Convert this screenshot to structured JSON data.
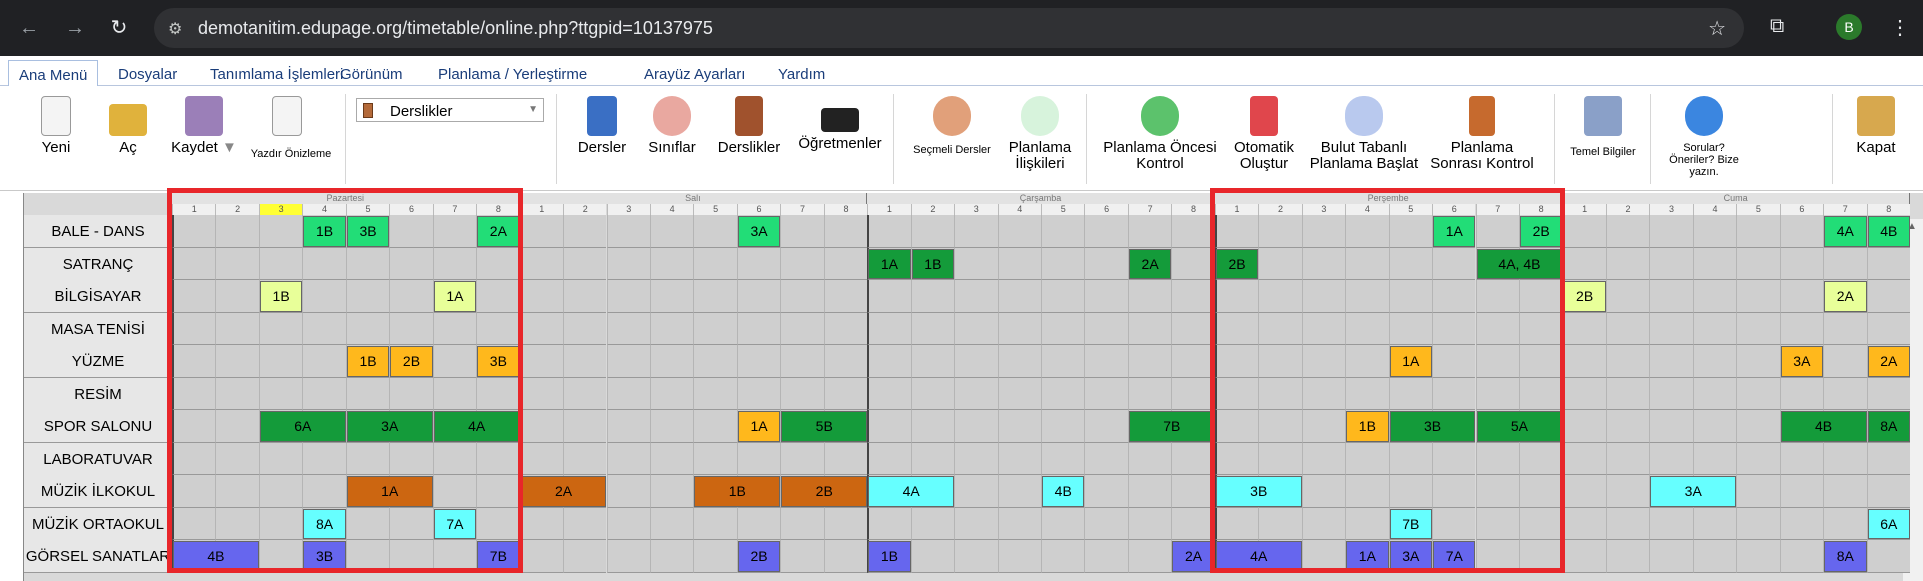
{
  "browser": {
    "url": "demotanitim.edupage.org/timetable/online.php?ttgpid=10137975",
    "profile_initial": "B"
  },
  "menubar": [
    "Ana Menü",
    "Dosyalar",
    "Tanımlama İşlemleri",
    "Görünüm",
    "Planlama / Yerleştirme",
    "Arayüz Ayarları",
    "Yardım"
  ],
  "ribbon": {
    "new": "Yeni",
    "open": "Aç",
    "save": "Kaydet",
    "print": "Yazdır Önizleme",
    "view_select": "Derslikler",
    "subjects": "Dersler",
    "classes": "Sınıflar",
    "rooms": "Derslikler",
    "teachers": "Öğretmenler",
    "elective": "Seçmeli Dersler",
    "relations": "Planlama İlişkileri",
    "precheck": "Planlama Öncesi Kontrol",
    "auto": "Otomatik Oluştur",
    "cloud": "Bulut Tabanlı Planlama Başlat",
    "postcheck": "Planlama Sonrası Kontrol",
    "basic": "Temel Bilgiler",
    "questions": "Sorular? Öneriler? Bize yazın.",
    "close": "Kapat"
  },
  "days": [
    "Pazartesi",
    "Salı",
    "Çarşamba",
    "Perşembe",
    "Cuma"
  ],
  "periods": [
    "1",
    "2",
    "3",
    "4",
    "5",
    "6",
    "7",
    "8"
  ],
  "highlight_period": {
    "day": 0,
    "period": 2
  },
  "rooms": [
    "BALE - DANS",
    "SATRANÇ",
    "BİLGİSAYAR",
    "MASA TENİSİ",
    "YÜZME",
    "RESİM",
    "SPOR SALONU",
    "LABORATUVAR",
    "MÜZİK İLKOKUL",
    "MÜZİK ORTAOKUL",
    "GÖRSEL SANATLAR"
  ],
  "colors": {
    "green": "#22dd77",
    "darkgreen": "#149b3a",
    "lime": "#e8ff99",
    "orange": "#ffb81c",
    "brown": "#cc6611",
    "cyan": "#66ffff",
    "blue": "#6666ee",
    "highlight": "#e8262a"
  },
  "cards": [
    {
      "room": 0,
      "day": 0,
      "p": 3,
      "len": 1,
      "label": "1B",
      "color": "green"
    },
    {
      "room": 0,
      "day": 0,
      "p": 4,
      "len": 1,
      "label": "3B",
      "color": "green"
    },
    {
      "room": 0,
      "day": 0,
      "p": 7,
      "len": 1,
      "label": "2A",
      "color": "green"
    },
    {
      "room": 0,
      "day": 1,
      "p": 5,
      "len": 1,
      "label": "3A",
      "color": "green"
    },
    {
      "room": 0,
      "day": 3,
      "p": 5,
      "len": 1,
      "label": "1A",
      "color": "green"
    },
    {
      "room": 0,
      "day": 3,
      "p": 7,
      "len": 1,
      "label": "2B",
      "color": "green"
    },
    {
      "room": 0,
      "day": 4,
      "p": 6,
      "len": 1,
      "label": "4A",
      "color": "green"
    },
    {
      "room": 0,
      "day": 4,
      "p": 7,
      "len": 1,
      "label": "4B",
      "color": "green"
    },
    {
      "room": 1,
      "day": 2,
      "p": 0,
      "len": 1,
      "label": "1A",
      "color": "darkgreen"
    },
    {
      "room": 1,
      "day": 2,
      "p": 1,
      "len": 1,
      "label": "1B",
      "color": "darkgreen"
    },
    {
      "room": 1,
      "day": 2,
      "p": 6,
      "len": 1,
      "label": "2A",
      "color": "darkgreen"
    },
    {
      "room": 1,
      "day": 3,
      "p": 0,
      "len": 1,
      "label": "2B",
      "color": "darkgreen"
    },
    {
      "room": 1,
      "day": 3,
      "p": 6,
      "len": 2,
      "label": "4A, 4B",
      "color": "darkgreen"
    },
    {
      "room": 2,
      "day": 0,
      "p": 2,
      "len": 1,
      "label": "1B",
      "color": "lime"
    },
    {
      "room": 2,
      "day": 0,
      "p": 6,
      "len": 1,
      "label": "1A",
      "color": "lime"
    },
    {
      "room": 2,
      "day": 4,
      "p": 0,
      "len": 1,
      "label": "2B",
      "color": "lime"
    },
    {
      "room": 2,
      "day": 4,
      "p": 6,
      "len": 1,
      "label": "2A",
      "color": "lime"
    },
    {
      "room": 4,
      "day": 0,
      "p": 4,
      "len": 1,
      "label": "1B",
      "color": "orange"
    },
    {
      "room": 4,
      "day": 0,
      "p": 5,
      "len": 1,
      "label": "2B",
      "color": "orange"
    },
    {
      "room": 4,
      "day": 0,
      "p": 7,
      "len": 1,
      "label": "3B",
      "color": "orange"
    },
    {
      "room": 4,
      "day": 3,
      "p": 4,
      "len": 1,
      "label": "1A",
      "color": "orange"
    },
    {
      "room": 4,
      "day": 4,
      "p": 5,
      "len": 1,
      "label": "3A",
      "color": "orange"
    },
    {
      "room": 4,
      "day": 4,
      "p": 7,
      "len": 1,
      "label": "2A",
      "color": "orange"
    },
    {
      "room": 6,
      "day": 0,
      "p": 2,
      "len": 2,
      "label": "6A",
      "color": "darkgreen"
    },
    {
      "room": 6,
      "day": 0,
      "p": 4,
      "len": 2,
      "label": "3A",
      "color": "darkgreen"
    },
    {
      "room": 6,
      "day": 0,
      "p": 6,
      "len": 2,
      "label": "4A",
      "color": "darkgreen"
    },
    {
      "room": 6,
      "day": 1,
      "p": 5,
      "len": 1,
      "label": "1A",
      "color": "orange"
    },
    {
      "room": 6,
      "day": 1,
      "p": 6,
      "len": 2,
      "label": "5B",
      "color": "darkgreen"
    },
    {
      "room": 6,
      "day": 2,
      "p": 6,
      "len": 2,
      "label": "7B",
      "color": "darkgreen"
    },
    {
      "room": 6,
      "day": 3,
      "p": 3,
      "len": 1,
      "label": "1B",
      "color": "orange"
    },
    {
      "room": 6,
      "day": 3,
      "p": 4,
      "len": 2,
      "label": "3B",
      "color": "darkgreen"
    },
    {
      "room": 6,
      "day": 3,
      "p": 6,
      "len": 2,
      "label": "5A",
      "color": "darkgreen"
    },
    {
      "room": 6,
      "day": 4,
      "p": 5,
      "len": 2,
      "label": "4B",
      "color": "darkgreen"
    },
    {
      "room": 6,
      "day": 4,
      "p": 7,
      "len": 1,
      "label": "8A",
      "color": "darkgreen"
    },
    {
      "room": 8,
      "day": 0,
      "p": 4,
      "len": 2,
      "label": "1A",
      "color": "brown"
    },
    {
      "room": 8,
      "day": 1,
      "p": 0,
      "len": 2,
      "label": "2A",
      "color": "brown"
    },
    {
      "room": 8,
      "day": 1,
      "p": 4,
      "len": 2,
      "label": "1B",
      "color": "brown"
    },
    {
      "room": 8,
      "day": 1,
      "p": 6,
      "len": 2,
      "label": "2B",
      "color": "brown"
    },
    {
      "room": 8,
      "day": 2,
      "p": 0,
      "len": 2,
      "label": "4A",
      "color": "cyan"
    },
    {
      "room": 8,
      "day": 2,
      "p": 4,
      "len": 1,
      "label": "4B",
      "color": "cyan"
    },
    {
      "room": 8,
      "day": 3,
      "p": 0,
      "len": 2,
      "label": "3B",
      "color": "cyan"
    },
    {
      "room": 8,
      "day": 4,
      "p": 2,
      "len": 2,
      "label": "3A",
      "color": "cyan"
    },
    {
      "room": 9,
      "day": 0,
      "p": 3,
      "len": 1,
      "label": "8A",
      "color": "cyan"
    },
    {
      "room": 9,
      "day": 0,
      "p": 6,
      "len": 1,
      "label": "7A",
      "color": "cyan"
    },
    {
      "room": 9,
      "day": 3,
      "p": 4,
      "len": 1,
      "label": "7B",
      "color": "cyan"
    },
    {
      "room": 9,
      "day": 4,
      "p": 7,
      "len": 1,
      "label": "6A",
      "color": "cyan"
    },
    {
      "room": 10,
      "day": 0,
      "p": 0,
      "len": 2,
      "label": "4B",
      "color": "blue"
    },
    {
      "room": 10,
      "day": 0,
      "p": 3,
      "len": 1,
      "label": "3B",
      "color": "blue"
    },
    {
      "room": 10,
      "day": 0,
      "p": 7,
      "len": 1,
      "label": "7B",
      "color": "blue"
    },
    {
      "room": 10,
      "day": 1,
      "p": 5,
      "len": 1,
      "label": "2B",
      "color": "blue"
    },
    {
      "room": 10,
      "day": 2,
      "p": 0,
      "len": 1,
      "label": "1B",
      "color": "blue"
    },
    {
      "room": 10,
      "day": 2,
      "p": 7,
      "len": 1,
      "label": "2A",
      "color": "blue"
    },
    {
      "room": 10,
      "day": 3,
      "p": 0,
      "len": 2,
      "label": "4A",
      "color": "blue"
    },
    {
      "room": 10,
      "day": 3,
      "p": 3,
      "len": 1,
      "label": "1A",
      "color": "blue"
    },
    {
      "room": 10,
      "day": 3,
      "p": 4,
      "len": 1,
      "label": "3A",
      "color": "blue"
    },
    {
      "room": 10,
      "day": 3,
      "p": 5,
      "len": 1,
      "label": "7A",
      "color": "blue"
    },
    {
      "room": 10,
      "day": 4,
      "p": 6,
      "len": 1,
      "label": "8A",
      "color": "blue"
    }
  ],
  "highlight_days": [
    0,
    3
  ]
}
